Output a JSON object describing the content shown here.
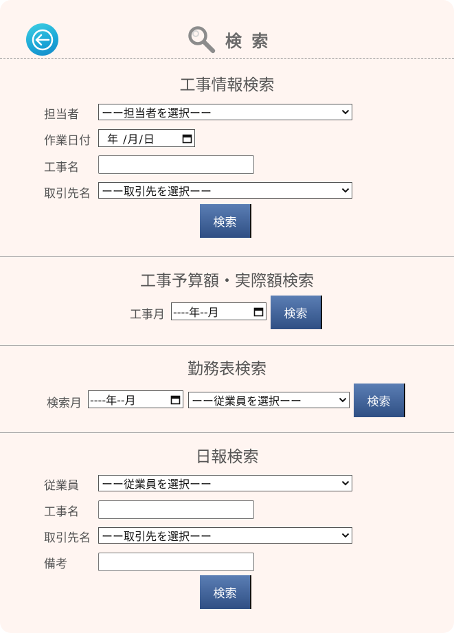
{
  "header": {
    "title": "検 索"
  },
  "construction_search": {
    "title": "工事情報検索",
    "person_label": "担当者",
    "person_select": "ーー担当者を選択ーー",
    "work_date_label": "作業日付",
    "work_date_value": "年 /月/日",
    "project_name_label": "工事名",
    "project_name_value": "",
    "client_label": "取引先名",
    "client_select": "ーー取引先を選択ーー",
    "search_label": "検索"
  },
  "budget_search": {
    "title": "工事予算額・実際額検索",
    "month_label": "工事月",
    "month_value": "----年--月",
    "search_label": "検索"
  },
  "attendance_search": {
    "title": "勤務表検索",
    "month_label": "検索月",
    "month_value": "----年--月",
    "employee_select": "ーー従業員を選択ーー",
    "search_label": "検索"
  },
  "daily_report_search": {
    "title": "日報検索",
    "employee_label": "従業員",
    "employee_select": "ーー従業員を選択ーー",
    "project_name_label": "工事名",
    "project_name_value": "",
    "client_label": "取引先名",
    "client_select": "ーー取引先を選択ーー",
    "remarks_label": "備考",
    "remarks_value": "",
    "search_label": "検索"
  },
  "icons": {
    "back": "arrow-left-icon",
    "title": "magnifier-icon",
    "dropdown": "chevron-down-icon",
    "calendar": "calendar-icon"
  },
  "colors": {
    "page_background": "#fff5f1",
    "back_button": "#1aa5d6",
    "search_button": "#3b5b92",
    "text": "#555555"
  }
}
